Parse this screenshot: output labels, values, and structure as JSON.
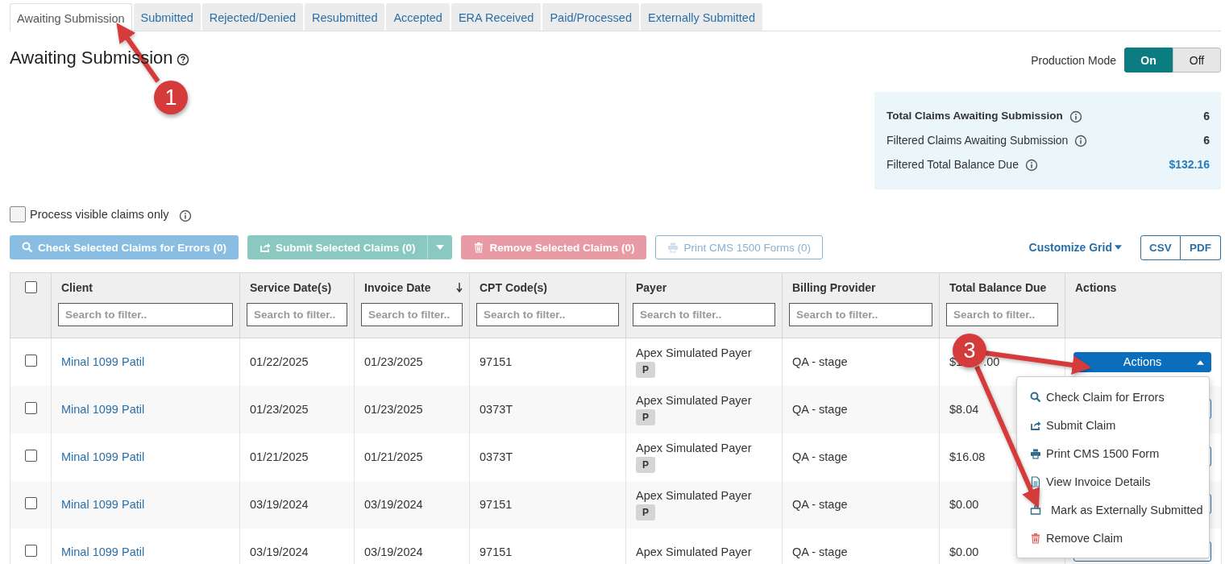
{
  "tabs": [
    {
      "label": "Awaiting Submission",
      "selected": true
    },
    {
      "label": "Submitted",
      "selected": false
    },
    {
      "label": "Rejected/Denied",
      "selected": false
    },
    {
      "label": "Resubmitted",
      "selected": false
    },
    {
      "label": "Accepted",
      "selected": false
    },
    {
      "label": "ERA Received",
      "selected": false
    },
    {
      "label": "Paid/Processed",
      "selected": false
    },
    {
      "label": "Externally Submitted",
      "selected": false
    }
  ],
  "heading": {
    "title": "Awaiting Submission"
  },
  "production_mode": {
    "label": "Production Mode",
    "options": [
      {
        "label": "On",
        "selected": true
      },
      {
        "label": "Off",
        "selected": false
      }
    ]
  },
  "summary": [
    {
      "label": "Total Claims Awaiting Submission",
      "value": "6",
      "bold": true,
      "kind": "count"
    },
    {
      "label": "Filtered Claims Awaiting Submission",
      "value": "6",
      "bold": false,
      "kind": "count"
    },
    {
      "label": "Filtered Total Balance Due",
      "value": "$132.16",
      "bold": false,
      "kind": "money"
    }
  ],
  "process_visible": {
    "label": "Process visible claims only",
    "checked": false
  },
  "toolbar": {
    "buttons": [
      {
        "label": "Check Selected Claims for Errors (0)",
        "kind": "check",
        "disabled": true
      },
      {
        "label": "Submit Selected Claims (0)",
        "kind": "submit",
        "disabled": true
      },
      {
        "label": "Remove Selected Claims (0)",
        "kind": "remove",
        "disabled": true
      },
      {
        "label": "Print CMS 1500 Forms (0)",
        "kind": "print",
        "disabled": true
      }
    ],
    "customize": "Customize Grid",
    "exports": [
      "CSV",
      "PDF"
    ]
  },
  "table": {
    "columns": [
      {
        "label": "Client",
        "placeholder": "Search to filter..",
        "sorted": false
      },
      {
        "label": "Service Date(s)",
        "placeholder": "Search to filter..",
        "sorted": false
      },
      {
        "label": "Invoice Date",
        "placeholder": "Search to filter..",
        "sorted": true
      },
      {
        "label": "CPT Code(s)",
        "placeholder": "Search to filter..",
        "sorted": false
      },
      {
        "label": "Payer",
        "placeholder": "Search to filter..",
        "sorted": false
      },
      {
        "label": "Billing Provider",
        "placeholder": "Search to filter..",
        "sorted": false
      },
      {
        "label": "Total Balance Due",
        "placeholder": "Search to filter..",
        "sorted": false
      },
      {
        "label": "Actions",
        "sorted": false
      }
    ],
    "select_all": {
      "checked": false
    },
    "rows": [
      {
        "checked": false,
        "client": "Minal 1099 Patil",
        "service_date": "01/22/2025",
        "invoice_date": "01/23/2025",
        "cpt": "97151",
        "payer": "Apex Simulated Payer",
        "payer_badge": "P",
        "billing_provider": "QA - stage",
        "balance": "$1",
        "balance_tail": ".00",
        "actions": {
          "label": "Actions",
          "expanded": true
        }
      },
      {
        "checked": false,
        "client": "Minal 1099 Patil",
        "service_date": "01/23/2025",
        "invoice_date": "01/23/2025",
        "cpt": "0373T",
        "payer": "Apex Simulated Payer",
        "payer_badge": "P",
        "billing_provider": "QA - stage",
        "balance": "$8.04",
        "actions": {
          "expanded": false
        }
      },
      {
        "checked": false,
        "client": "Minal 1099 Patil",
        "service_date": "01/21/2025",
        "invoice_date": "01/21/2025",
        "cpt": "0373T",
        "payer": "Apex Simulated Payer",
        "payer_badge": "P",
        "billing_provider": "QA - stage",
        "balance": "$16.08",
        "actions": {
          "expanded": false
        }
      },
      {
        "checked": false,
        "client": "Minal 1099 Patil",
        "service_date": "03/19/2024",
        "invoice_date": "03/19/2024",
        "cpt": "97151",
        "payer": "Apex Simulated Payer",
        "payer_badge": "P",
        "billing_provider": "QA - stage",
        "balance": "$0.00",
        "actions": {
          "expanded": false
        }
      },
      {
        "checked": false,
        "client": "Minal 1099 Patil",
        "service_date": "03/19/2024",
        "invoice_date": "03/19/2024",
        "cpt": "97151",
        "payer": "Apex Simulated Payer",
        "billing_provider": "QA - stage",
        "balance": "$0.00",
        "actions": {
          "expanded": false
        }
      }
    ]
  },
  "actions_menu": [
    {
      "label": "Check Claim for Errors",
      "kind": "check"
    },
    {
      "label": "Submit Claim",
      "kind": "submit"
    },
    {
      "label": "Print CMS 1500 Form",
      "kind": "print"
    },
    {
      "label": "View Invoice Details",
      "kind": "view"
    },
    {
      "label": "Mark as Externally Submitted",
      "kind": "mark"
    },
    {
      "label": "Remove Claim",
      "kind": "remove"
    }
  ],
  "annotations": [
    {
      "number": "1"
    },
    {
      "number": "3"
    }
  ]
}
